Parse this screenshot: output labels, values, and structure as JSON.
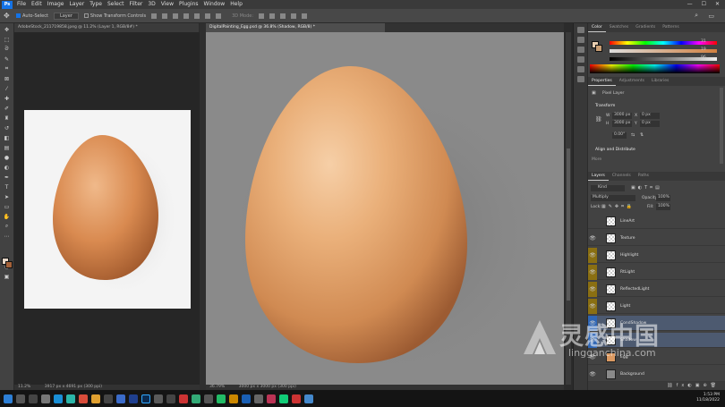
{
  "menu": {
    "app_badge": "Ps",
    "items": [
      "File",
      "Edit",
      "Image",
      "Layer",
      "Type",
      "Select",
      "Filter",
      "3D",
      "View",
      "Plugins",
      "Window",
      "Help"
    ]
  },
  "options": {
    "auto_select_label": "Auto-Select",
    "auto_select_value": "Layer",
    "transform_label": "Show Transform Controls",
    "mode_label": "3D Mode:"
  },
  "tabs": {
    "doc1": "AdobeStock_211719858.jpeg @ 11.2% (Layer 1, RGB/8#) *",
    "doc2": "DigitalPainting_Egg.psd @ 36.8% (Shadow, RGB/8) *"
  },
  "status": {
    "doc1_zoom": "11.2%",
    "doc1_info": "3917 px x 4691 px (300 ppi)",
    "doc2_zoom": "36.79%",
    "doc2_info": "3000 px x 3000 px (300 ppi)"
  },
  "color_panel": {
    "tabs": [
      "Color",
      "Swatches",
      "Gradients",
      "Patterns"
    ],
    "values": [
      "31",
      "19",
      "96"
    ]
  },
  "properties_panel": {
    "tabs": [
      "Properties",
      "Adjustments",
      "Libraries"
    ],
    "kind": "Pixel Layer",
    "section_transform": "Transform",
    "w": "3000 px",
    "h": "3000 px",
    "x": "0 px",
    "y": "0 px",
    "angle": "0.00°",
    "section_align": "Align and Distribute",
    "more": "More"
  },
  "layers_panel": {
    "tabs": [
      "Layers",
      "Channels",
      "Paths"
    ],
    "filter_kind": "Kind",
    "blend_mode": "Multiply",
    "opacity_label": "Opacity:",
    "opacity_value": "100%",
    "lock_label": "Lock:",
    "fill_label": "Fill:",
    "fill_value": "100%",
    "layers": [
      {
        "name": "LineArt",
        "visible": false,
        "tint": false,
        "selected": false
      },
      {
        "name": "Texture",
        "visible": true,
        "tint": false,
        "selected": false
      },
      {
        "name": "Highlight",
        "visible": true,
        "tint": true,
        "selected": false
      },
      {
        "name": "RtLight",
        "visible": true,
        "tint": true,
        "selected": false
      },
      {
        "name": "ReflectedLight",
        "visible": true,
        "tint": true,
        "selected": false
      },
      {
        "name": "Light",
        "visible": true,
        "tint": true,
        "selected": false
      },
      {
        "name": "CondShadow",
        "visible": true,
        "tint": false,
        "selected": true
      },
      {
        "name": "Shadow",
        "visible": true,
        "tint": false,
        "selected": true
      },
      {
        "name": "Egg",
        "visible": true,
        "tint": false,
        "selected": false
      },
      {
        "name": "Background",
        "visible": true,
        "tint": false,
        "selected": false
      }
    ]
  },
  "taskbar": {
    "time": "1:53 PM",
    "date": "11/18/2022"
  },
  "watermark": {
    "cn": "灵感中国",
    "en": "lingganchina.com"
  },
  "colors": {
    "egg_light": "#f3c59a",
    "egg_mid": "#dc9a62",
    "egg_dark": "#a5623a",
    "layer_tint": "#8a6f12",
    "selected": "#2f66b5"
  }
}
